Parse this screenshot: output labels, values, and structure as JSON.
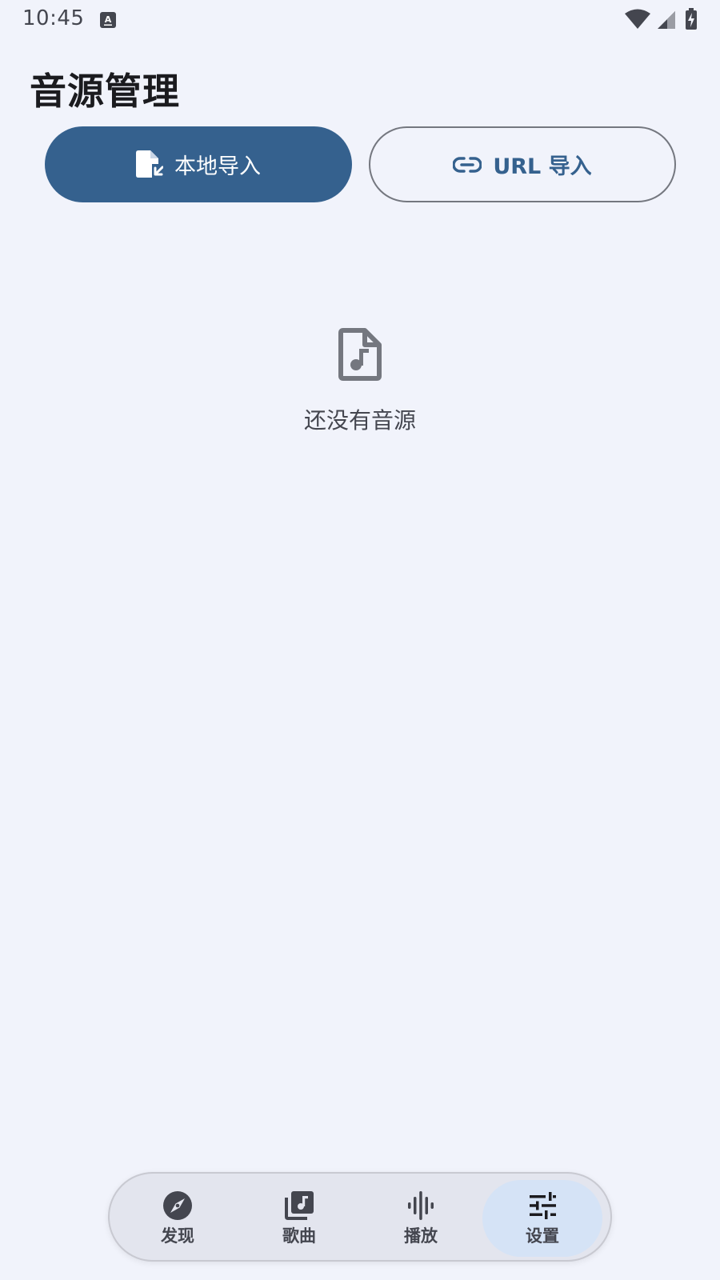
{
  "status_bar": {
    "time": "10:45",
    "icons": [
      "keyboard-notification-icon",
      "wifi-icon",
      "cellular-signal-icon",
      "battery-charging-icon"
    ]
  },
  "page": {
    "title": "音源管理"
  },
  "actions": {
    "local_import_label": "本地导入",
    "url_import_label": "URL 导入"
  },
  "empty_state": {
    "icon": "music-file-icon",
    "message": "还没有音源"
  },
  "bottom_nav": {
    "items": [
      {
        "label": "发现",
        "icon": "compass-icon",
        "active": false
      },
      {
        "label": "歌曲",
        "icon": "music-library-icon",
        "active": false
      },
      {
        "label": "播放",
        "icon": "waveform-icon",
        "active": false
      },
      {
        "label": "设置",
        "icon": "tune-icon",
        "active": true
      }
    ]
  },
  "colors": {
    "background": "#f1f3fb",
    "primary": "#35618e",
    "on_surface": "#1b1b1f",
    "outline": "#74777f",
    "active_indicator": "#d5e3f6"
  }
}
